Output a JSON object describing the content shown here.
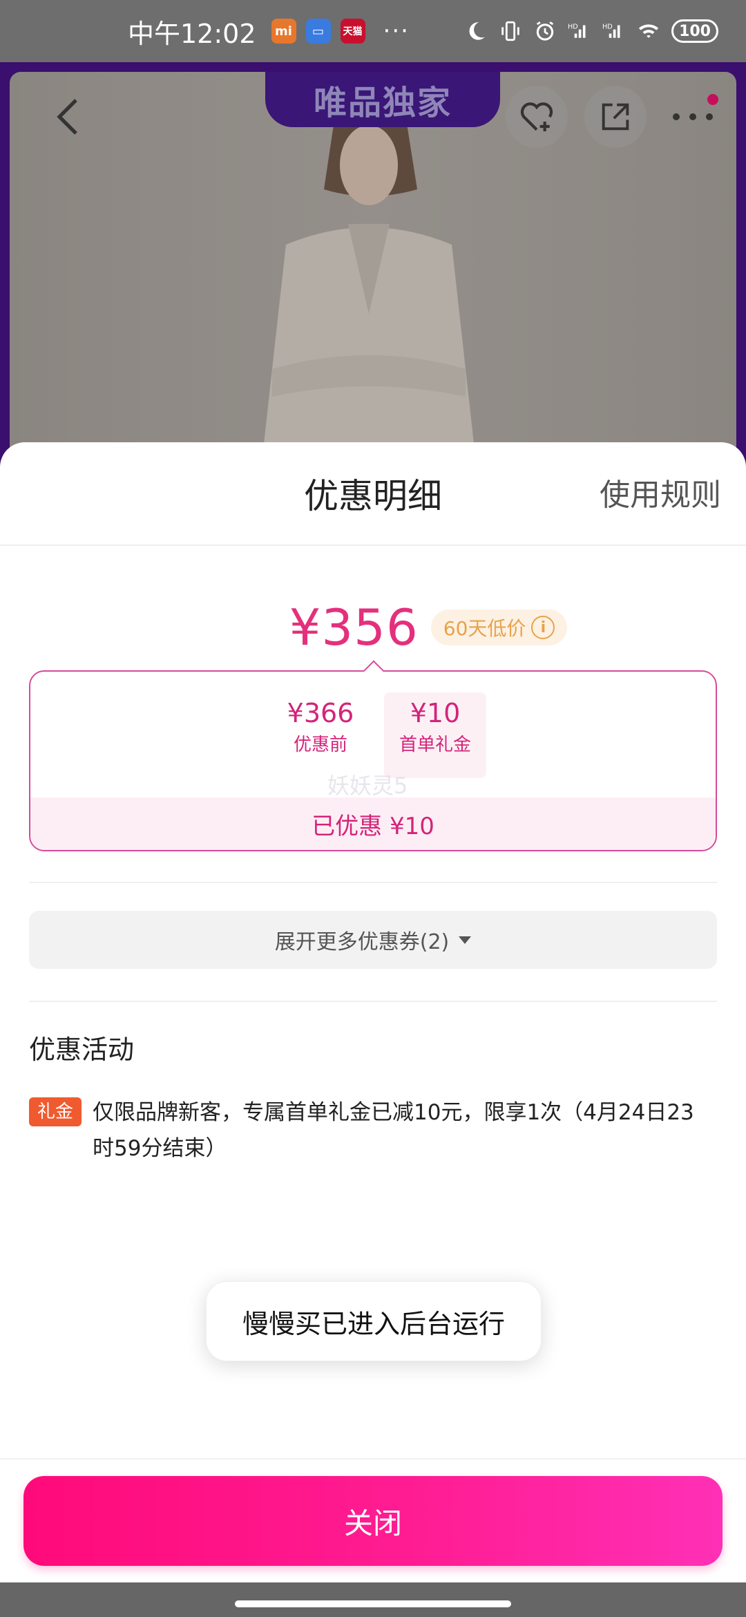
{
  "status_bar": {
    "time": "中午12:02",
    "app_icons": [
      "mi",
      "wallet",
      "天猫"
    ],
    "more": "···",
    "battery": "100"
  },
  "product": {
    "tag": "唯品独家"
  },
  "sheet": {
    "title": "优惠明细",
    "rules_link": "使用规则",
    "final_price": "¥356",
    "low_price_badge": "60天低价",
    "breakdown": {
      "before_amount": "¥366",
      "before_label": "优惠前",
      "operator": "-",
      "gift_amount": "¥10",
      "gift_label": "首单礼金",
      "watermark": "妖妖灵5"
    },
    "saved_text": "已优惠 ¥10",
    "expand_button": "展开更多优惠券(2)",
    "section_title": "优惠活动",
    "promo": {
      "tag": "礼金",
      "text": "仅限品牌新客，专属首单礼金已减10元，限享1次（4月24日23时59分结束）"
    },
    "toast": "慢慢买已进入后台运行",
    "close_button": "关闭"
  },
  "colors": {
    "accent_pink": "#e4307c",
    "button_gradient_start": "#ff0a7a",
    "button_gradient_end": "#ff30b6",
    "promo_tag": "#f05a2f",
    "badge_orange": "#e8a24a"
  }
}
